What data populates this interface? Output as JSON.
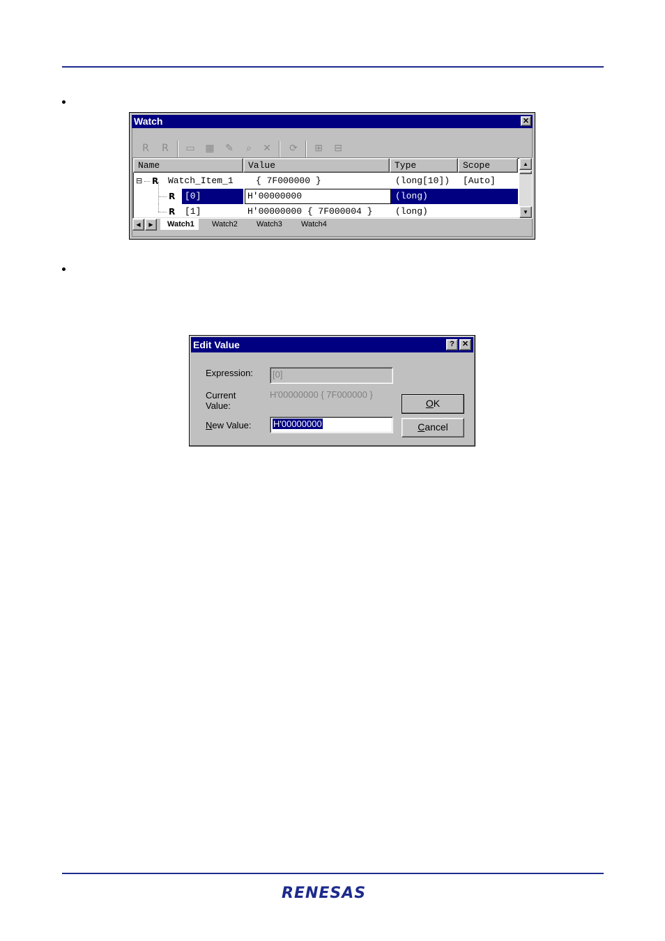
{
  "watch": {
    "title": "Watch",
    "close_glyph": "✕",
    "toolbar_icons": [
      "register-icon",
      "register-alt-icon",
      "camera-icon",
      "edit-window-icon",
      "pencil-icon",
      "find-icon",
      "delete-icon",
      "refresh-icon",
      "expand-icon",
      "collapse-icon"
    ],
    "columns": [
      "Name",
      "Value",
      "Type",
      "Scope"
    ],
    "rows": [
      {
        "expander": "⊟",
        "name": "Watch_Item_1",
        "value": "{ 7F000000 }",
        "type": "(long[10])",
        "scope": "[Auto]"
      },
      {
        "name": "[0]",
        "value": "H'00000000",
        "type": "(long)",
        "scope": "",
        "selected": true,
        "editing": true
      },
      {
        "name": "[1]",
        "value": "H'00000000 { 7F000004 }",
        "type": "(long)",
        "scope": ""
      }
    ],
    "tabs": [
      "Watch1",
      "Watch2",
      "Watch3",
      "Watch4"
    ],
    "active_tab": "Watch1"
  },
  "dialog": {
    "title": "Edit Value",
    "help_glyph": "?",
    "close_glyph": "✕",
    "expression_label": "Expression:",
    "expression_value": "[0]",
    "current_label_1": "Current",
    "current_label_2": "Value:",
    "current_value": "H'00000000 { 7F000000 }",
    "new_value_label_prefix": "N",
    "new_value_label_rest": "ew Value:",
    "new_value": "H'00000000",
    "ok_prefix": "O",
    "ok_rest": "K",
    "cancel_prefix": "C",
    "cancel_rest": "ancel"
  },
  "footer": {
    "logo": "RENESAS"
  },
  "colors": {
    "rule": "#1c2b8c",
    "titlebar": "#000080",
    "selection": "#000080",
    "face": "#c0c0c0"
  }
}
